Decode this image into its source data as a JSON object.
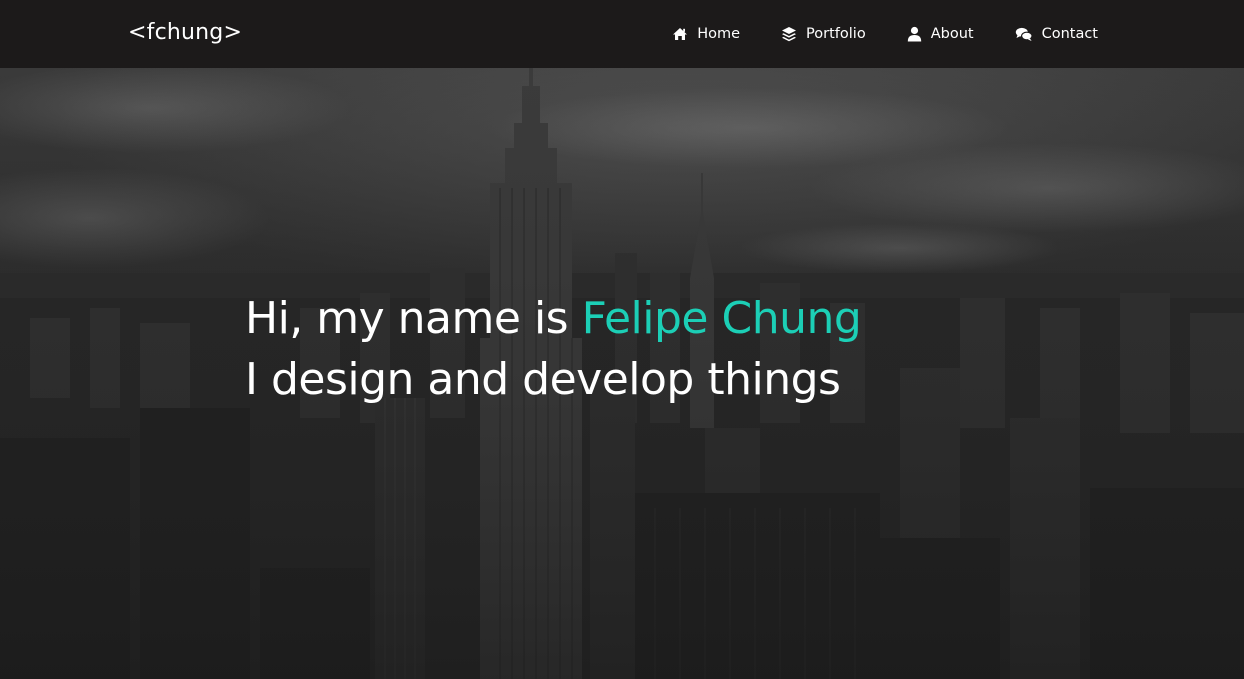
{
  "brand": {
    "text": "<fchung>"
  },
  "nav": {
    "items": [
      {
        "label": "Home",
        "icon": "home-icon"
      },
      {
        "label": "Portfolio",
        "icon": "layers-icon"
      },
      {
        "label": "About",
        "icon": "user-icon"
      },
      {
        "label": "Contact",
        "icon": "chat-icon"
      }
    ]
  },
  "hero": {
    "intro": "Hi, my name is ",
    "name": "Felipe Chung",
    "tagline": "I design and develop things"
  },
  "colors": {
    "accent": "#1ccfb6",
    "navbar": "#1c1a1a",
    "text": "#ffffff"
  }
}
